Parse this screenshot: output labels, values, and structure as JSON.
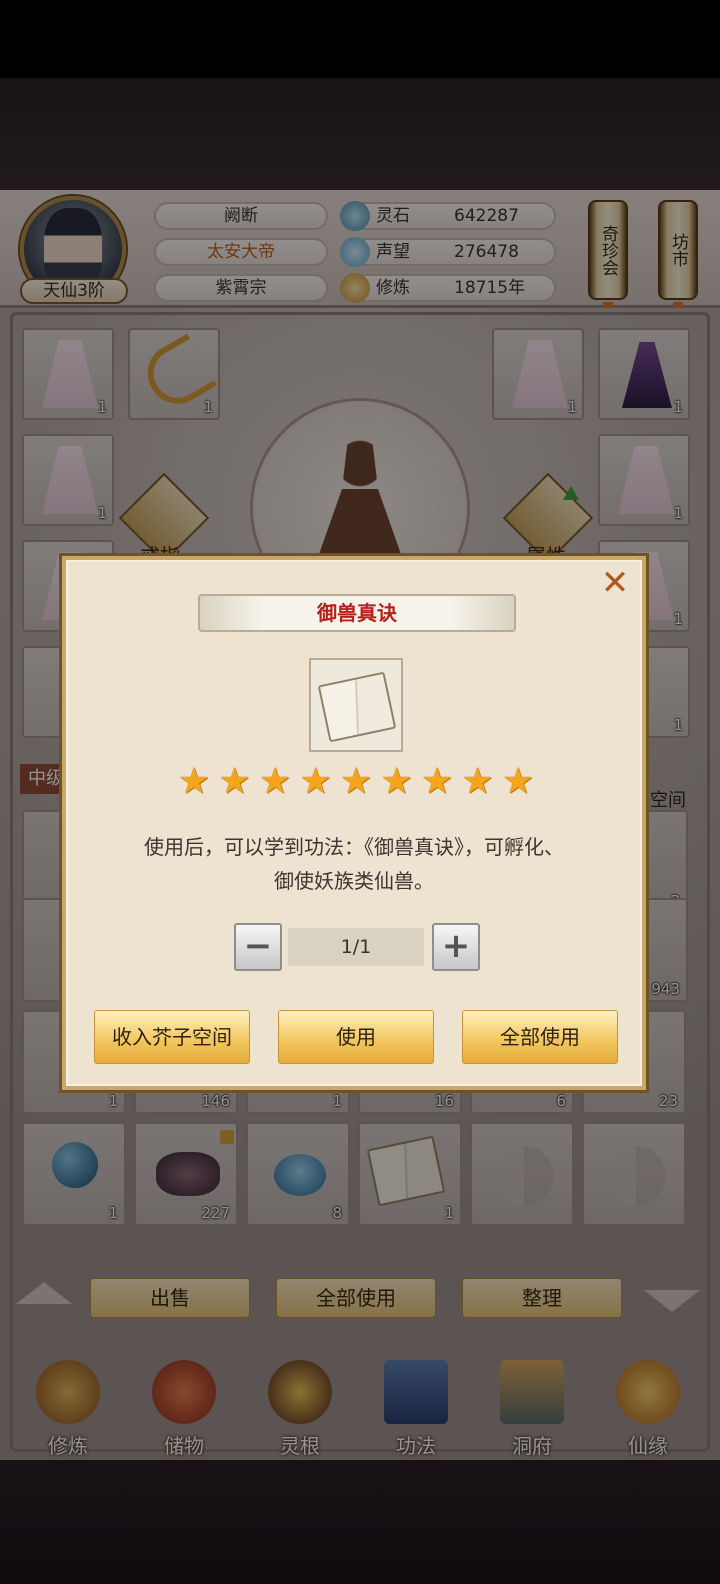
{
  "header": {
    "rank": "天仙3阶",
    "plates": [
      "阙断",
      "太安大帝",
      "紫霄宗"
    ],
    "stats": [
      {
        "icon": "spirit-stone-icon",
        "label": "灵石",
        "value": "642287"
      },
      {
        "icon": "reputation-icon",
        "label": "声望",
        "value": "276478"
      },
      {
        "icon": "cultivation-icon",
        "label": "修炼",
        "value": "18715年"
      }
    ],
    "side_buttons": [
      "奇珍会",
      "坊市"
    ]
  },
  "equipment": {
    "ring_label": "戒指",
    "attr_label": "属性",
    "grade_tag": "中级",
    "space_tab": "芥子空间",
    "slots_count": [
      "1",
      "1",
      "1",
      "1",
      "1",
      "1",
      "1",
      "1",
      "1",
      "1"
    ]
  },
  "inventory": {
    "row_counts": [
      "1",
      "146",
      "1",
      "16",
      "6",
      "23"
    ],
    "row2_counts": [
      "1",
      "227",
      "8",
      "1"
    ],
    "right_counts": [
      "3",
      "943"
    ]
  },
  "bag_actions": [
    "出售",
    "全部使用",
    "整理"
  ],
  "nav": [
    "修炼",
    "储物",
    "灵根",
    "功法",
    "洞府",
    "仙缘"
  ],
  "modal": {
    "title": "御兽真诀",
    "star_count": 9,
    "description_line1": "使用后，可以学到功法：《御兽真诀》，可孵化、",
    "description_line2": "御使妖族类仙兽。",
    "quantity": "1/1",
    "minus": "−",
    "plus": "+",
    "buttons": [
      "收入芥子空间",
      "使用",
      "全部使用"
    ],
    "close": "✕"
  }
}
